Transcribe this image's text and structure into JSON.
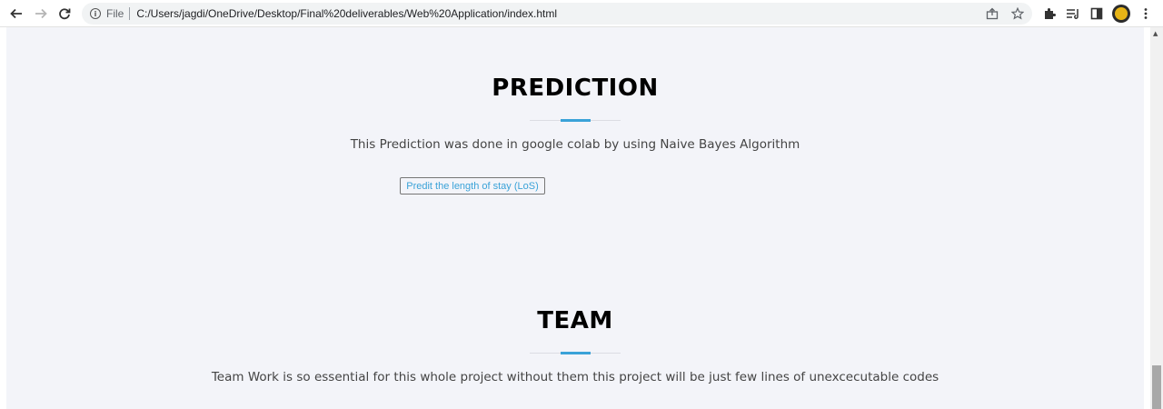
{
  "browser": {
    "file_label": "File",
    "url": "C:/Users/jagdi/OneDrive/Desktop/Final%20deliverables/Web%20Application/index.html",
    "icons": {
      "back": "back-arrow-icon",
      "forward": "forward-arrow-icon",
      "reload": "reload-icon",
      "info": "info-icon",
      "share": "share-icon",
      "bookmark": "star-icon",
      "extensions": "puzzle-icon",
      "reading_list": "reading-list-icon",
      "side_panel": "side-panel-icon",
      "menu": "kebab-menu-icon"
    }
  },
  "prediction": {
    "title": "PREDICTION",
    "description": "This Prediction was done in google colab by using Naive Bayes Algorithm",
    "button_label": "Predit the length of stay (LoS)"
  },
  "team": {
    "title": "TEAM",
    "description": "Team Work is so essential for this whole project without them this project will be just few lines of unexcecutable codes"
  },
  "colors": {
    "accent": "#3aa2d8",
    "page_background": "#f3f4f9"
  }
}
